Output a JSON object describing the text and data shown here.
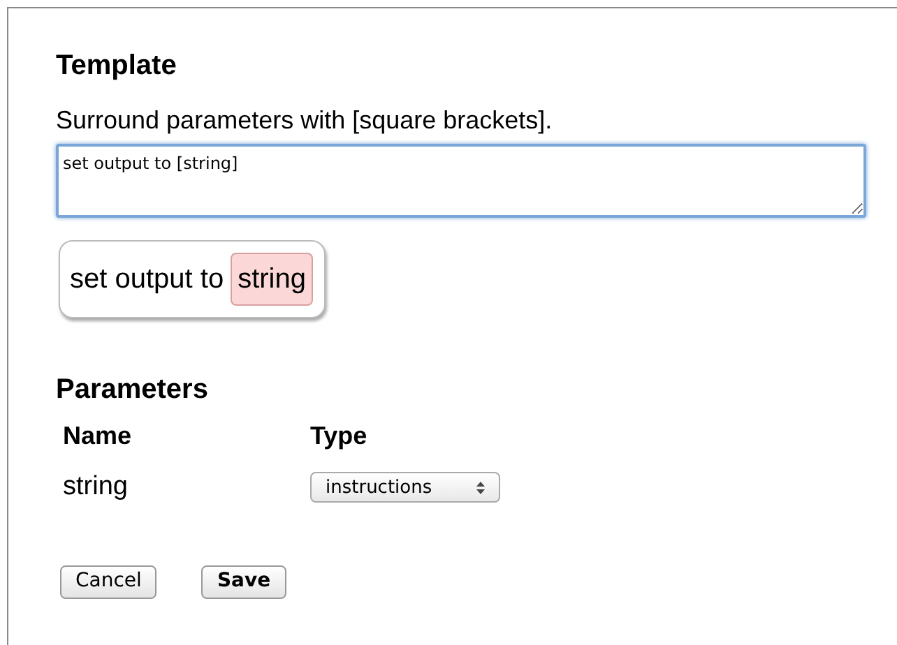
{
  "template": {
    "heading": "Template",
    "hint": "Surround parameters with [square brackets].",
    "value": "set output to [string]",
    "preview": [
      {
        "kind": "text",
        "text": "set output to"
      },
      {
        "kind": "param",
        "text": "string"
      }
    ]
  },
  "parameters": {
    "heading": "Parameters",
    "columns": [
      "Name",
      "Type"
    ],
    "rows": [
      {
        "name": "string",
        "type": "instructions"
      }
    ]
  },
  "buttons": [
    {
      "label": "Cancel",
      "kind": "normal"
    },
    {
      "label": "Save",
      "kind": "primary"
    }
  ]
}
